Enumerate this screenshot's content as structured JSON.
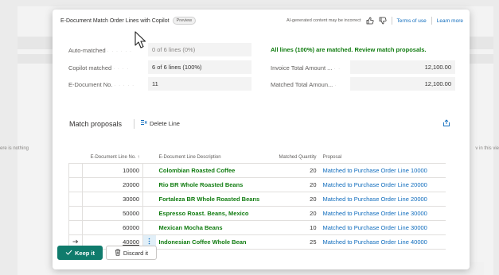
{
  "background": {
    "left_text": "ere is nothing",
    "right_text": "v in this vie"
  },
  "header": {
    "title": "E-Document Match Order Lines with Copilot",
    "badge": "Preview",
    "ai_notice": "AI-generated content may be incorrect",
    "terms_link": "Terms of use",
    "learn_link": "Learn more"
  },
  "fields": {
    "auto_matched_label": "Auto-matched",
    "auto_matched_value": "0 of 6 lines (0%)",
    "copilot_matched_label": "Copilot matched",
    "copilot_matched_value": "6 of 6 lines (100%)",
    "edoc_no_label": "E-Document No.",
    "edoc_no_value": "11",
    "status_message": "All lines (100%) are matched. Review match proposals.",
    "invoice_total_label": "Invoice Total Amount ...",
    "invoice_total_value": "12,100.00",
    "matched_total_label": "Matched Total Amoun...",
    "matched_total_value": "12,100.00"
  },
  "match_proposals": {
    "title": "Match proposals",
    "delete_label": "Delete Line",
    "columns": {
      "line_no": "E-Document Line No. ↑",
      "desc": "E-Document Line Description",
      "qty": "Matched Quantity",
      "proposal": "Proposal"
    },
    "rows": [
      {
        "line_no": "10000",
        "desc": "Colombian Roasted Coffee",
        "qty": "20",
        "proposal": "Matched to Purchase Order Line 10000"
      },
      {
        "line_no": "20000",
        "desc": "Rio BR Whole Roasted Beans",
        "qty": "20",
        "proposal": "Matched to Purchase Order Line 20000"
      },
      {
        "line_no": "30000",
        "desc": "Fortaleza BR Whole Roasted Beans",
        "qty": "20",
        "proposal": "Matched to Purchase Order Line 20000"
      },
      {
        "line_no": "50000",
        "desc": "Espresso Roast. Beans, Mexico",
        "qty": "20",
        "proposal": "Matched to Purchase Order Line 30000"
      },
      {
        "line_no": "60000",
        "desc": "Mexican Mocha Beans",
        "qty": "10",
        "proposal": "Matched to Purchase Order Line 30000"
      },
      {
        "line_no": "40000",
        "desc": "Indonesian Coffee Whole Bean",
        "qty": "25",
        "proposal": "Matched to Purchase Order Line 40000"
      }
    ]
  },
  "footer": {
    "keep_label": "Keep it",
    "discard_label": "Discard it"
  }
}
